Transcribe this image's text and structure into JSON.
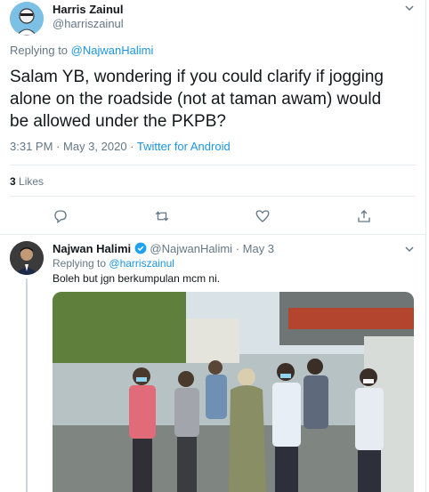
{
  "main_tweet": {
    "author_name": "Harris Zainul",
    "author_handle": "@harriszainul",
    "replying_prefix": "Replying to",
    "replying_to": "@NajwanHalimi",
    "text": "Salam YB, wondering if you could clarify if jogging alone on the roadside (not at taman awam) would be allowed under the PKPB?",
    "time": "3:31 PM",
    "dot": "·",
    "date": "May 3, 2020",
    "client": "Twitter for Android",
    "likes_count": "3",
    "likes_label": "Likes"
  },
  "actions": [
    "reply-icon",
    "retweet-icon",
    "like-icon",
    "share-icon"
  ],
  "reply_tweet": {
    "author_name": "Najwan Halimi",
    "author_handle": "@NajwanHalimi",
    "date_text": "· May 3",
    "replying_prefix": "Replying to",
    "replying_to": "@harriszainul",
    "text": "Boleh but jgn berkumpulan mcm ni."
  },
  "colors": {
    "link": "#1b95e0",
    "muted": "#657786",
    "verified": "#1da1f2",
    "divider": "#e6ecf0"
  }
}
